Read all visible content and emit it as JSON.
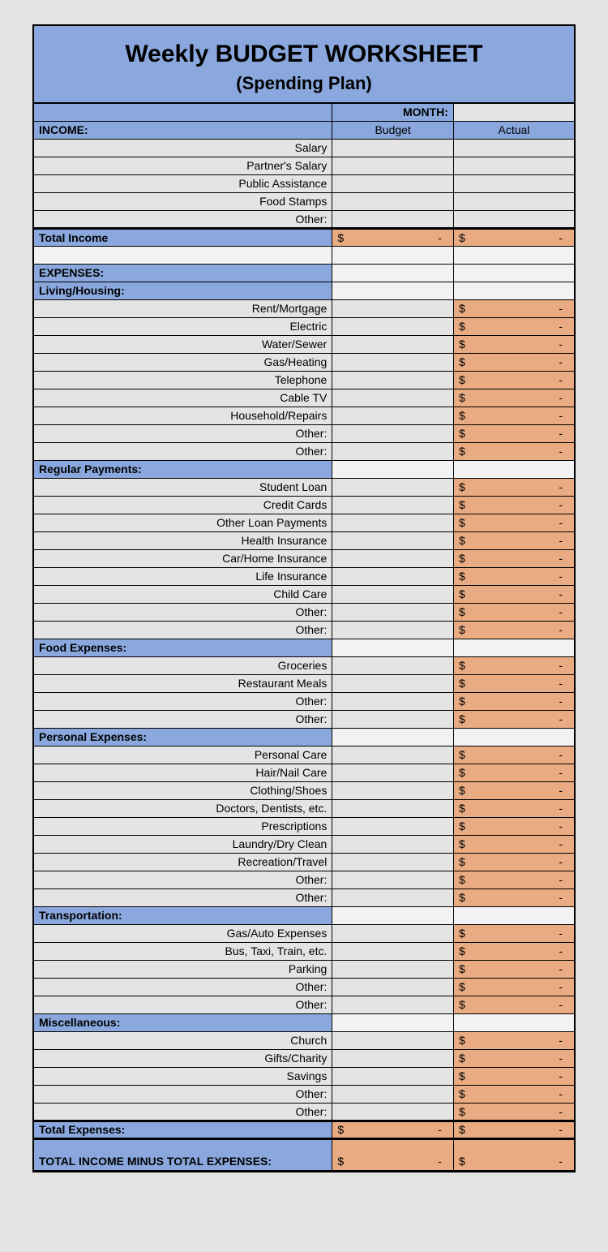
{
  "title": "Weekly BUDGET WORKSHEET",
  "subtitle": "(Spending Plan)",
  "month_label": "MONTH:",
  "col_budget": "Budget",
  "col_actual": "Actual",
  "income_header": "INCOME:",
  "income_items": [
    "Salary",
    "Partner's Salary",
    "Public Assistance",
    "Food Stamps",
    "Other:"
  ],
  "total_income_label": "Total Income",
  "expenses_header": "EXPENSES:",
  "sections": [
    {
      "name": "Living/Housing:",
      "items": [
        "Rent/Mortgage",
        "Electric",
        "Water/Sewer",
        "Gas/Heating",
        "Telephone",
        "Cable TV",
        "Household/Repairs",
        "Other:",
        "Other:"
      ]
    },
    {
      "name": "Regular Payments:",
      "items": [
        "Student Loan",
        "Credit Cards",
        "Other Loan Payments",
        "Health Insurance",
        "Car/Home Insurance",
        "Life Insurance",
        "Child Care",
        "Other:",
        "Other:"
      ]
    },
    {
      "name": "Food Expenses:",
      "items": [
        "Groceries",
        "Restaurant Meals",
        "Other:",
        "Other:"
      ]
    },
    {
      "name": "Personal Expenses:",
      "items": [
        "Personal Care",
        "Hair/Nail Care",
        "Clothing/Shoes",
        "Doctors, Dentists, etc.",
        "Prescriptions",
        "Laundry/Dry Clean",
        "Recreation/Travel",
        "Other:",
        "Other:"
      ]
    },
    {
      "name": "Transportation:",
      "items": [
        "Gas/Auto Expenses",
        "Bus, Taxi, Train, etc.",
        "Parking",
        "Other:",
        "Other:"
      ]
    },
    {
      "name": "Miscellaneous:",
      "items": [
        "Church",
        "Gifts/Charity",
        "Savings",
        "Other:",
        "Other:"
      ]
    }
  ],
  "total_expenses_label": "Total Expenses:",
  "net_label": "TOTAL INCOME MINUS TOTAL EXPENSES:",
  "dollar": "$",
  "dash": "-"
}
